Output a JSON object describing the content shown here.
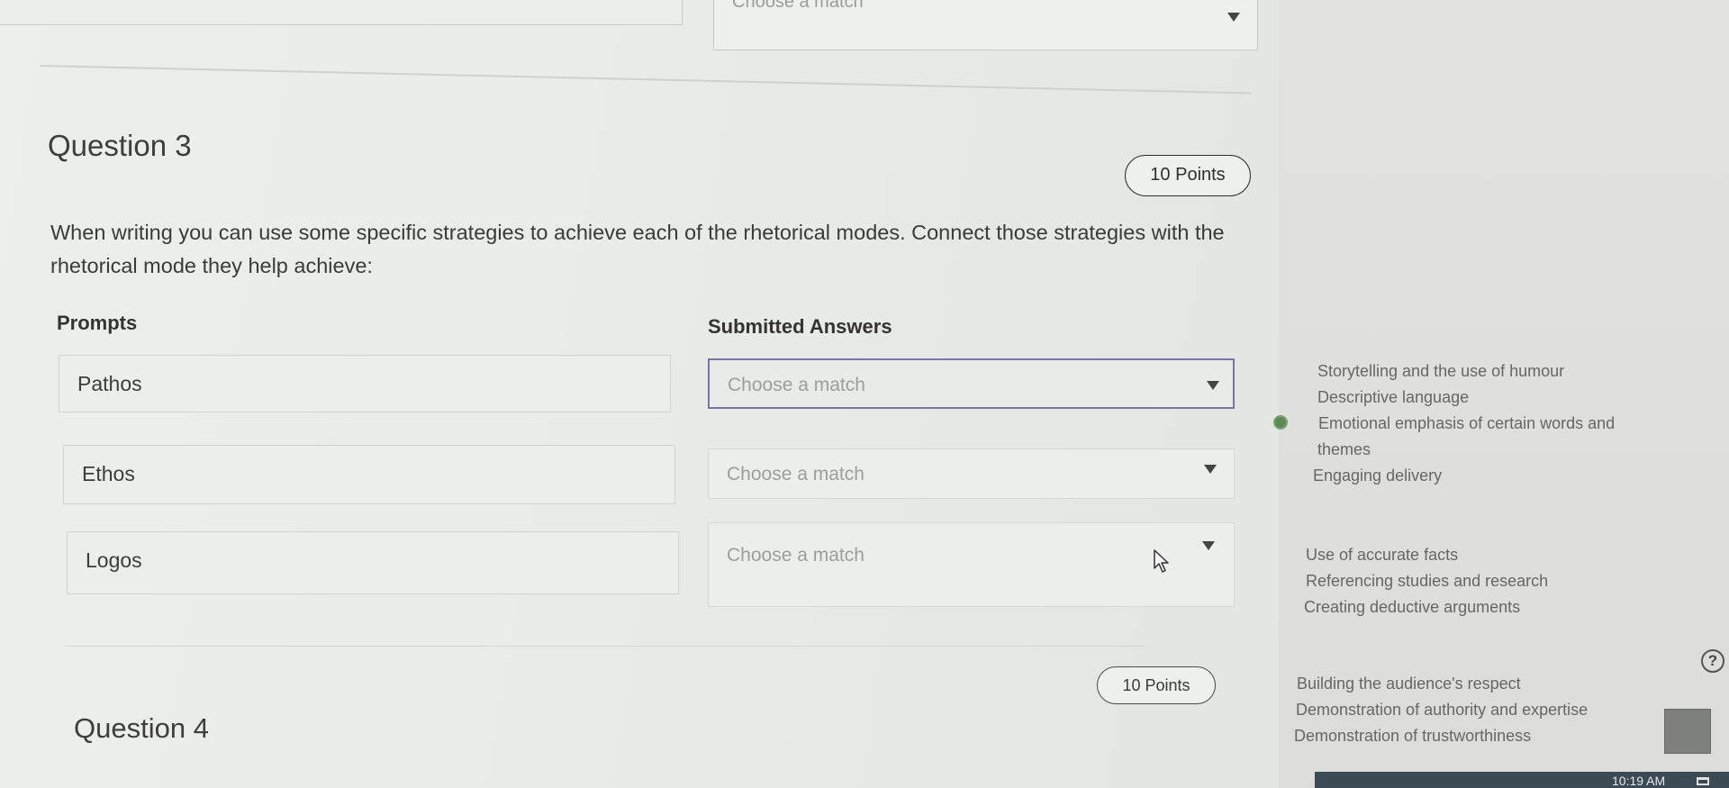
{
  "top_select": {
    "placeholder": "Choose a match"
  },
  "question3": {
    "title": "Question 3",
    "points": "10 Points",
    "prompt": "When writing you can use some specific strategies to achieve each of the rhetorical modes. Connect those strategies with the rhetorical mode they help achieve:",
    "prompts_header": "Prompts",
    "answers_header": "Submitted Answers",
    "rows": [
      {
        "prompt": "Pathos",
        "answer": "Choose a match"
      },
      {
        "prompt": "Ethos",
        "answer": "Choose a match"
      },
      {
        "prompt": "Logos",
        "answer": "Choose a match"
      }
    ]
  },
  "options": {
    "group1": [
      "Storytelling and the use of humour",
      "Descriptive language",
      "Emotional emphasis of certain words and",
      "themes",
      "Engaging delivery"
    ],
    "group2": [
      "Use of accurate facts",
      "Referencing studies and research",
      "Creating deductive arguments"
    ],
    "group3": [
      "Building the audience's respect",
      "Demonstration of authority and expertise",
      "Demonstration of trustworthiness"
    ]
  },
  "question4": {
    "title": "Question 4",
    "points": "10 Points"
  },
  "taskbar": {
    "time": "10:19 AM"
  },
  "icons": {
    "help": "?"
  }
}
